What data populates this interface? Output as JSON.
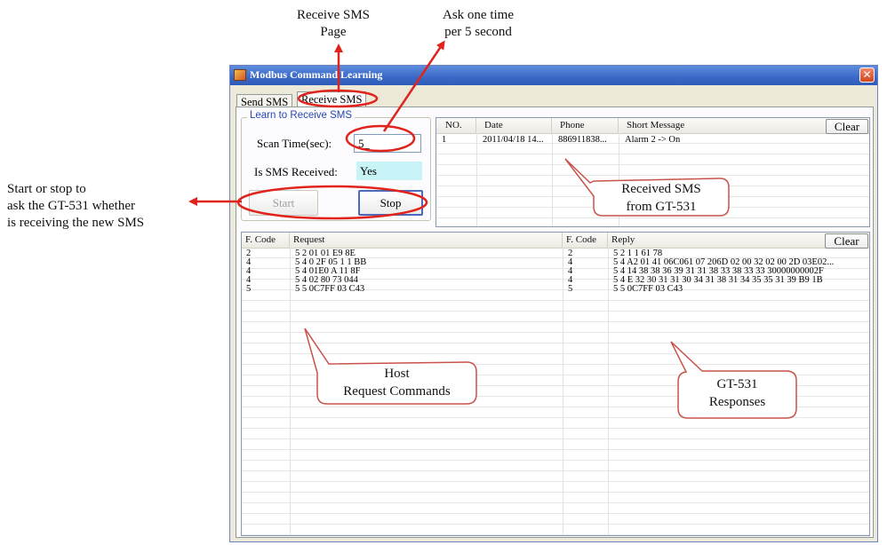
{
  "annotations": {
    "receive_page_line1": "Receive SMS",
    "receive_page_line2": "Page",
    "ask_line1": "Ask one time",
    "ask_line2": "per 5 second",
    "start_stop_line1": "Start or stop to",
    "start_stop_line2": "ask the GT-531 whether",
    "start_stop_line3": "is receiving the new SMS",
    "received_line1": "Received SMS",
    "received_line2": "from GT-531",
    "host_line1": "Host",
    "host_line2": "Request Commands",
    "responses_line1": "GT-531",
    "responses_line2": "Responses"
  },
  "window": {
    "title": "Modbus Command Learning",
    "close_glyph": "✕"
  },
  "tabs": [
    {
      "label": "Send SMS"
    },
    {
      "label": "Receive SMS"
    }
  ],
  "learn_group": {
    "title": "Learn to Receive SMS",
    "scan_label": "Scan Time(sec):",
    "scan_value": "5_",
    "received_label": "Is SMS Received:",
    "received_value": "Yes",
    "start_label": "Start",
    "stop_label": "Stop"
  },
  "sms_list": {
    "clear_label": "Clear",
    "columns": [
      "NO.",
      "Date",
      "Phone",
      "Short Message"
    ],
    "rows": [
      [
        "1",
        "2011/04/18 14...",
        "886911838...",
        "Alarm 2 -> On"
      ]
    ]
  },
  "command_list": {
    "clear_label": "Clear",
    "columns": [
      "F. Code",
      "Request",
      "F. Code",
      "Reply"
    ],
    "rows": [
      [
        "2",
        "5 2 01 01 E9 8E",
        "2",
        "5 2 1 1 61 78"
      ],
      [
        "4",
        "5 4 0 2F 05 1 1 BB",
        "4",
        "5 4 A2 01 41 06C061 07 206D 02 00 32 02 00 2D 03E02..."
      ],
      [
        "4",
        "5 4 01E0 A 11 8F",
        "4",
        "5 4 14 38 38 36 39 31 31 38 33 38 33 33 30000000002F"
      ],
      [
        "4",
        "5 4 02 80 73 044",
        "4",
        "5 4 E 32 30 31 31 30 34 31 38 31 34 35 35 31 39 B9 1B"
      ],
      [
        "5",
        "5 5 0C7FF 03 C43",
        "5",
        "5 5 0C7FF 03 C43"
      ]
    ]
  },
  "colors": {
    "highlight_red": "#e0241c",
    "titlebar_blue": "#3a68c6",
    "yes_background": "#c8f4f8"
  }
}
